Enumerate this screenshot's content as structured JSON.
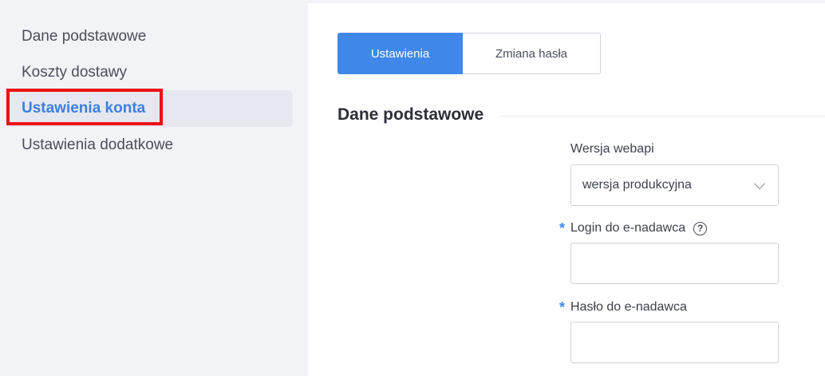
{
  "sidebar": {
    "items": [
      {
        "label": "Dane podstawowe",
        "active": false
      },
      {
        "label": "Koszty dostawy",
        "active": false
      },
      {
        "label": "Ustawienia konta",
        "active": true
      },
      {
        "label": "Ustawienia dodatkowe",
        "active": false
      }
    ]
  },
  "tabs": [
    {
      "label": "Ustawienia",
      "active": true
    },
    {
      "label": "Zmiana hasła",
      "active": false
    }
  ],
  "section": {
    "title": "Dane podstawowe"
  },
  "form": {
    "webapi": {
      "label": "Wersja webapi",
      "value": "wersja produkcyjna"
    },
    "login": {
      "label": "Login do e-nadawca",
      "required_mark": "*",
      "help_icon": "?",
      "value": ""
    },
    "password": {
      "label": "Hasło do e-nadawca",
      "required_mark": "*",
      "value": ""
    }
  },
  "colors": {
    "accent": "#3f88e8",
    "highlight": "#ee1111",
    "sidebar_bg": "#f2f3f7"
  }
}
